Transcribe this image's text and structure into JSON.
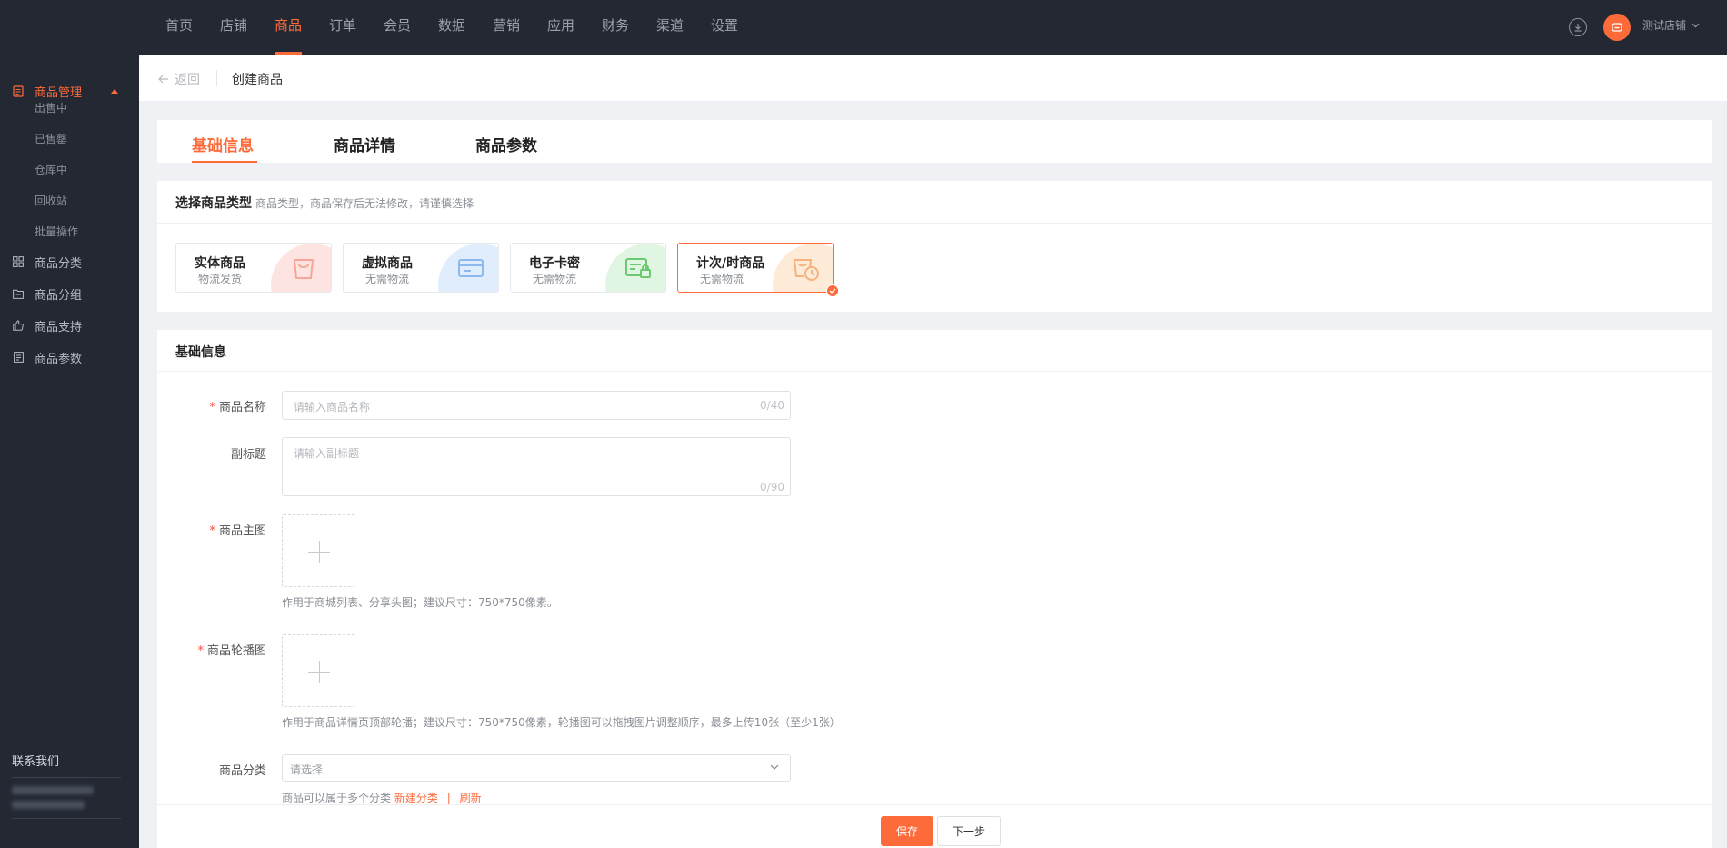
{
  "topnav": {
    "items": [
      "首页",
      "店铺",
      "商品",
      "订单",
      "会员",
      "数据",
      "营销",
      "应用",
      "财务",
      "渠道",
      "设置"
    ],
    "active_index": 2,
    "shop_name": "测试店铺"
  },
  "sidebar": {
    "group": "商品管理",
    "subitems": [
      "出售中",
      "已售罄",
      "仓库中",
      "回收站",
      "批量操作"
    ],
    "items": [
      "商品分类",
      "商品分组",
      "商品支持",
      "商品参数"
    ],
    "contact_title": "联系我们"
  },
  "header": {
    "back_label": "返回",
    "title": "创建商品"
  },
  "tabs": [
    "基础信息",
    "商品详情",
    "商品参数"
  ],
  "product_type": {
    "title": "选择商品类型",
    "hint": "商品类型，商品保存后无法修改，请谨慎选择",
    "options": [
      {
        "name": "实体商品",
        "sub": "物流发货",
        "color": "#fde4e0",
        "icon_color": "#f7a79a"
      },
      {
        "name": "虚拟商品",
        "sub": "无需物流",
        "color": "#e0edfd",
        "icon_color": "#8db9ef"
      },
      {
        "name": "电子卡密",
        "sub": "无需物流",
        "color": "#e1f6e2",
        "icon_color": "#6cc96f"
      },
      {
        "name": "计次/时商品",
        "sub": "无需物流",
        "color": "#fdebd8",
        "icon_color": "#f5b27c"
      }
    ],
    "selected_index": 3
  },
  "basic_info": {
    "title": "基础信息",
    "name_label": "商品名称",
    "name_placeholder": "请输入商品名称",
    "name_counter": "0/40",
    "subtitle_label": "副标题",
    "subtitle_placeholder": "请输入副标题",
    "subtitle_counter": "0/90",
    "main_image_label": "商品主图",
    "main_image_tip": "作用于商城列表、分享头图；建议尺寸：750*750像素。",
    "carousel_label": "商品轮播图",
    "carousel_tip": "作用于商品详情页顶部轮播；建议尺寸：750*750像素，轮播图可以拖拽图片调整顺序，最多上传10张（至少1张）",
    "category_label": "商品分类",
    "category_placeholder": "请选择",
    "category_tip": "商品可以属于多个分类",
    "category_new": "新建分类",
    "category_sep": "|",
    "category_refresh": "刷新"
  },
  "footer": {
    "save_label": "保存",
    "next_label": "下一步"
  },
  "colors": {
    "accent": "#fe6b3b",
    "nav_bg": "#232833"
  }
}
